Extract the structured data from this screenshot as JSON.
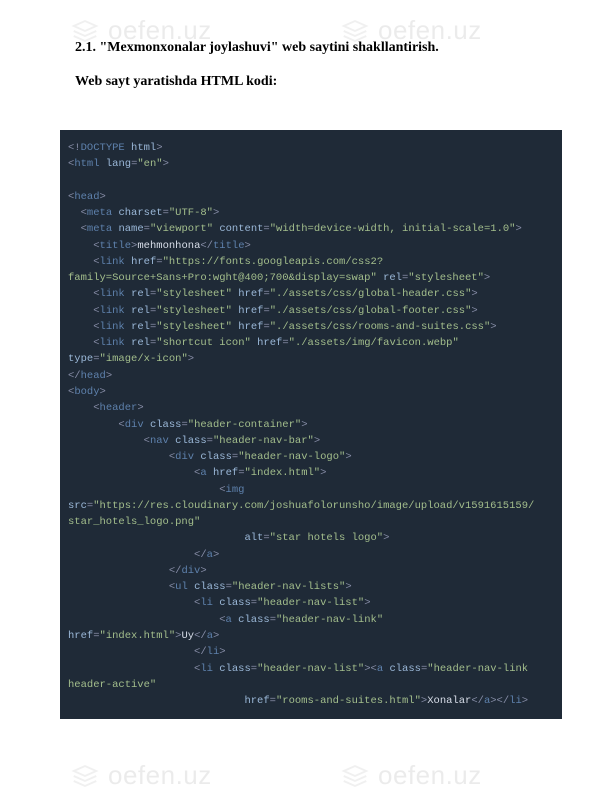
{
  "watermark": {
    "text": "oefen.uz"
  },
  "headings": {
    "h1": "2.1. \"Mexmonxonalar joylashuvi\" web saytini shakllantirish.",
    "h2": "Web sayt yaratishda HTML kodi:"
  },
  "code": {
    "doctype": {
      "lt": "<!",
      "name": "DOCTYPE",
      "sp": " ",
      "val": "html",
      "gt": ">"
    },
    "html_open": "html",
    "html_lang_attr": "lang",
    "html_lang_val": "\"en\"",
    "head": "head",
    "meta1_tag": "meta",
    "meta1_attr": "charset",
    "meta1_val": "\"UTF-8\"",
    "meta2_tag": "meta",
    "meta2_name_attr": "name",
    "meta2_name_val": "\"viewport\"",
    "meta2_content_attr": "content",
    "meta2_content_val": "\"width=device-width, initial-scale=1.0\"",
    "title_tag": "title",
    "title_text": "mehmonhona",
    "link1_tag": "link",
    "link1_href_attr": "href",
    "link1_href_val": "\"https://fonts.googleapis.com/css2?",
    "link1_href_val2": "family=Source+Sans+Pro:wght@400;700&display=swap\"",
    "link1_rel_attr": "rel",
    "link1_rel_val": "\"stylesheet\"",
    "link2_rel_val": "\"stylesheet\"",
    "link2_href_val": "\"./assets/css/global-header.css\"",
    "link3_rel_val": "\"stylesheet\"",
    "link3_href_val": "\"./assets/css/global-footer.css\"",
    "link4_rel_val": "\"stylesheet\"",
    "link4_href_val": "\"./assets/css/rooms-and-suites.css\"",
    "link5_rel_val": "\"shortcut icon\"",
    "link5_href_val": "\"./assets/img/favicon.webp\"",
    "link5_type_attr": "type",
    "link5_type_val": "\"image/x-icon\"",
    "body": "body",
    "header": "header",
    "div": "div",
    "class_attr": "class",
    "hc_val": "\"header-container\"",
    "nav": "nav",
    "hnb_val": "\"header-nav-bar\"",
    "hnl_val": "\"header-nav-logo\"",
    "a": "a",
    "href_attr": "href",
    "idx_val": "\"index.html\"",
    "img": "img",
    "src_attr": "src",
    "src_val1": "\"https://res.cloudinary.com/joshuafolorunsho/image/upload/v1591615159/",
    "src_val2": "star_hotels_logo.png\"",
    "alt_attr": "alt",
    "alt_val": "\"star hotels logo\"",
    "ul": "ul",
    "hnls_val": "\"header-nav-lists\"",
    "li": "li",
    "hnli_val": "\"header-nav-list\"",
    "hnlk_val": "\"header-nav-link\"",
    "uy_text": "Uy",
    "hnlka_val": "\"header-nav-link ",
    "hactive_val": "header-active\"",
    "rooms_href_val": "\"rooms-and-suites.html\"",
    "xonalar_text": "Xonalar",
    "rel_attr": "rel",
    "link_tag": "link"
  }
}
